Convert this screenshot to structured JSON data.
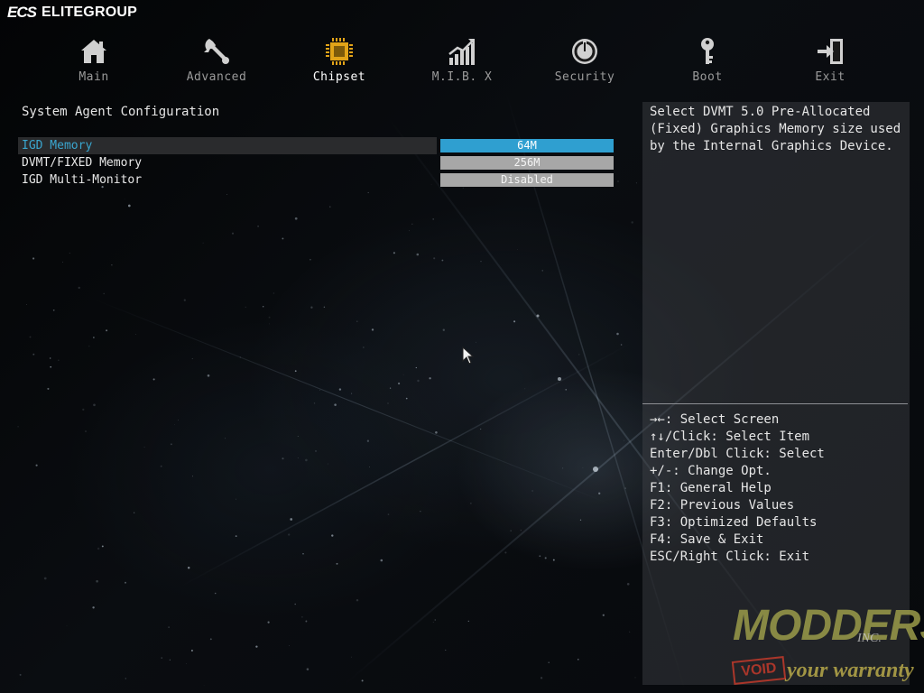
{
  "brand": {
    "mark": "ECS",
    "name": "ELITEGROUP"
  },
  "nav": {
    "items": [
      {
        "label": "Main",
        "icon": "home-icon"
      },
      {
        "label": "Advanced",
        "icon": "wrench-icon"
      },
      {
        "label": "Chipset",
        "icon": "chip-icon",
        "active": true
      },
      {
        "label": "M.I.B. X",
        "icon": "performance-chart-icon"
      },
      {
        "label": "Security",
        "icon": "power-shield-icon"
      },
      {
        "label": "Boot",
        "icon": "key-icon"
      },
      {
        "label": "Exit",
        "icon": "exit-door-icon"
      }
    ]
  },
  "section": {
    "title": "System Agent Configuration"
  },
  "settings": [
    {
      "label": "IGD Memory",
      "value": "64M",
      "selected": true
    },
    {
      "label": "DVMT/FIXED Memory",
      "value": "256M"
    },
    {
      "label": "IGD Multi-Monitor",
      "value": "Disabled"
    }
  ],
  "help": {
    "description": "Select DVMT 5.0 Pre-Allocated (Fixed) Graphics Memory size used by the Internal Graphics Device.",
    "keys": [
      "→←: Select Screen",
      "↑↓/Click: Select Item",
      "Enter/Dbl Click: Select",
      "+/-: Change Opt.",
      "F1: General Help",
      "F2: Previous Values",
      "F3: Optimized Defaults",
      "F4: Save & Exit",
      "ESC/Right Click: Exit"
    ]
  },
  "watermark": {
    "brand": "MODDERS",
    "suffix": "INC.",
    "stamp": "VOID",
    "tagline": "your warranty"
  },
  "colors": {
    "accent": "#2f9fd0",
    "selected_label": "#3aa6cf",
    "option_bg": "#a7a7a7",
    "chipset_icon": "#e2a418"
  }
}
